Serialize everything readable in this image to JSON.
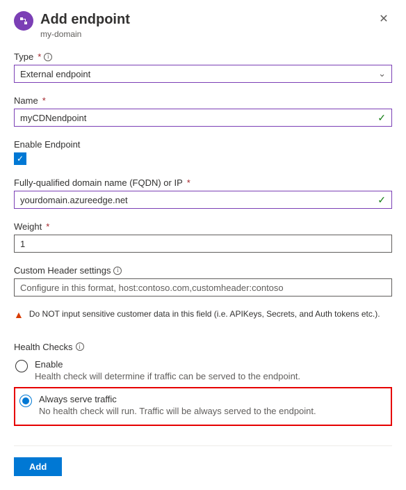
{
  "header": {
    "title": "Add endpoint",
    "subtitle": "my-domain"
  },
  "type": {
    "label": "Type",
    "value": "External endpoint"
  },
  "name": {
    "label": "Name",
    "value": "myCDNendpoint"
  },
  "enableEndpoint": {
    "label": "Enable Endpoint",
    "checked": true
  },
  "fqdn": {
    "label": "Fully-qualified domain name (FQDN) or IP",
    "value": "yourdomain.azureedge.net"
  },
  "weight": {
    "label": "Weight",
    "value": "1"
  },
  "customHeader": {
    "label": "Custom Header settings",
    "placeholder": "Configure in this format, host:contoso.com,customheader:contoso"
  },
  "warning": "Do NOT input sensitive customer data in this field (i.e. APIKeys, Secrets, and Auth tokens etc.).",
  "healthChecks": {
    "label": "Health Checks",
    "enable": {
      "label": "Enable",
      "desc": "Health check will determine if traffic can be served to the endpoint."
    },
    "always": {
      "label": "Always serve traffic",
      "desc": "No health check will run. Traffic will be always served to the endpoint."
    }
  },
  "footer": {
    "add": "Add"
  }
}
